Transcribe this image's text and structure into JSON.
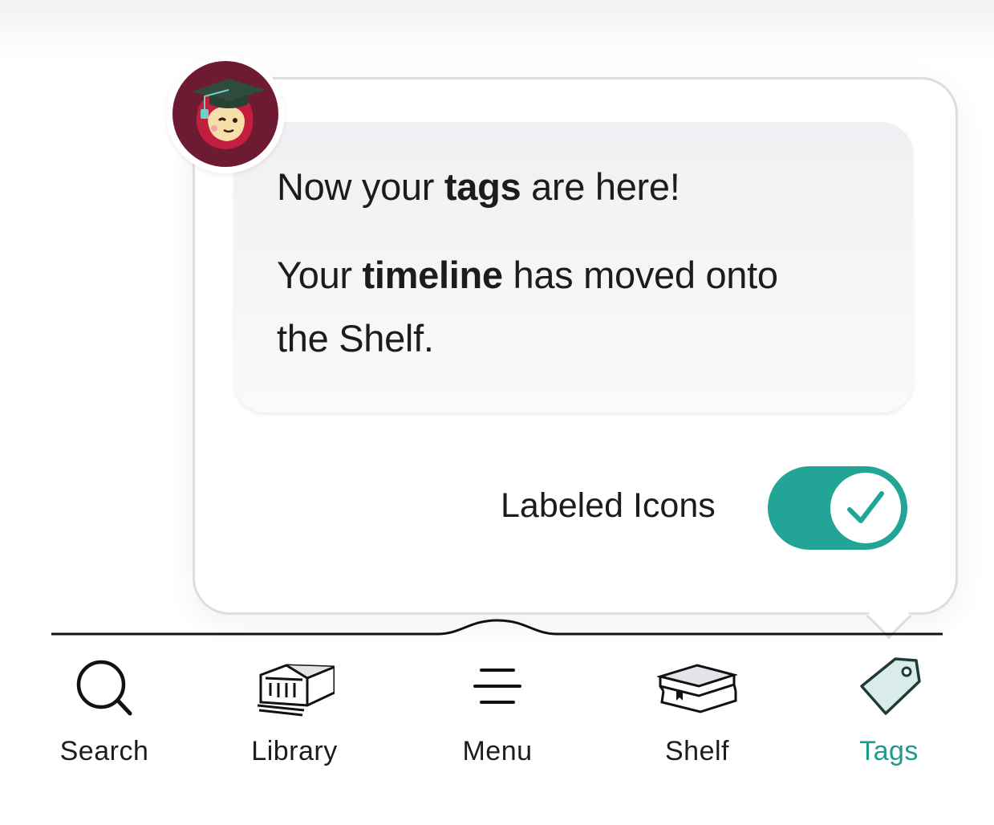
{
  "popover": {
    "message_line1_before": "Now your ",
    "message_line1_bold": "tags",
    "message_line1_after": " are here!",
    "message_line2_before": "Your ",
    "message_line2_bold": "timeline",
    "message_line2_after": " has moved onto",
    "message_line3": "the Shelf.",
    "toggle_label": "Labeled Icons",
    "toggle_on": true
  },
  "tabbar": {
    "tabs": [
      {
        "label": "Search",
        "icon": "search-icon"
      },
      {
        "label": "Library",
        "icon": "library-icon"
      },
      {
        "label": "Menu",
        "icon": "menu-icon"
      },
      {
        "label": "Shelf",
        "icon": "shelf-icon"
      },
      {
        "label": "Tags",
        "icon": "tag-icon",
        "active": true
      }
    ]
  },
  "colors": {
    "accent": "#22a596",
    "active_label": "#1f9a8b",
    "avatar_bg": "#6e1a33"
  }
}
